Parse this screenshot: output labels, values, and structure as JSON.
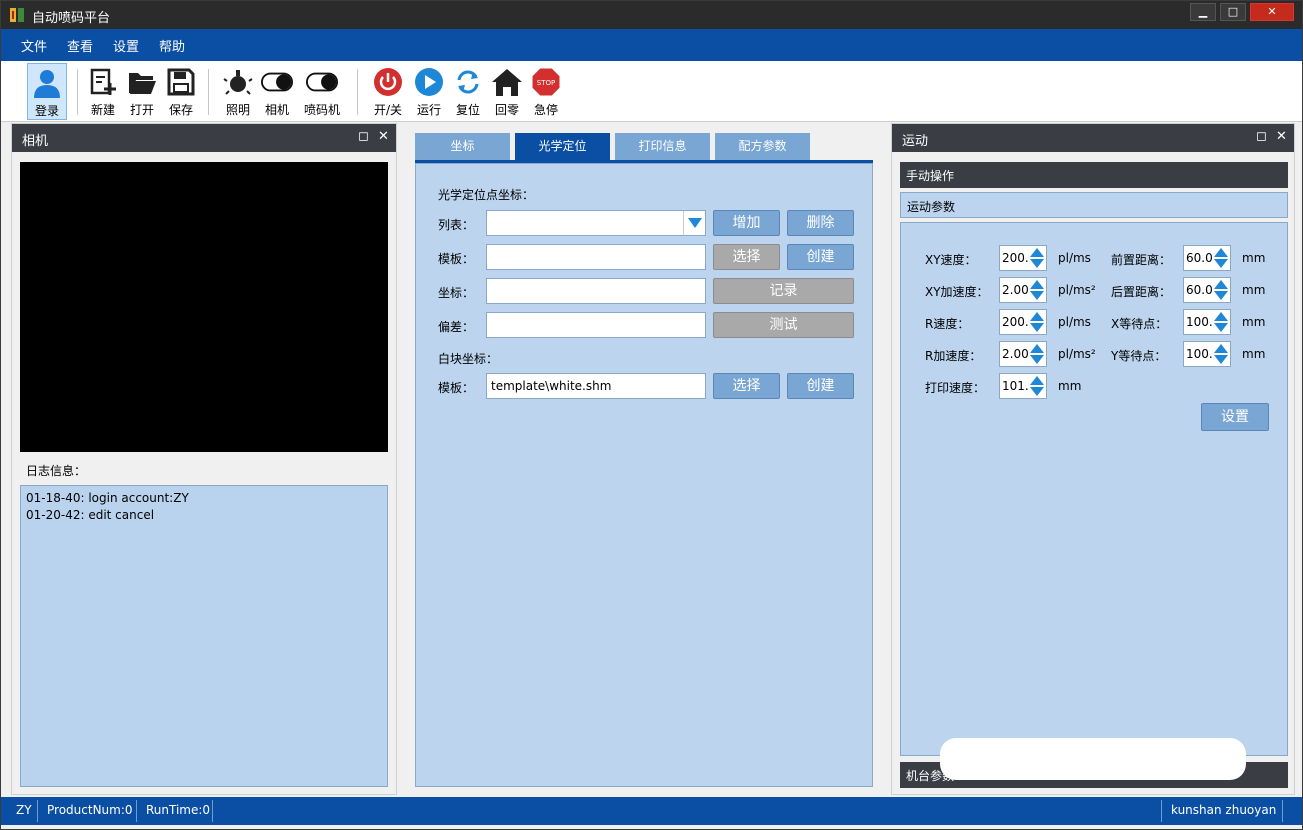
{
  "window": {
    "title": "自动喷码平台"
  },
  "menu": [
    "文件",
    "查看",
    "设置",
    "帮助"
  ],
  "toolbar": {
    "login": "登录",
    "new": "新建",
    "open": "打开",
    "save": "保存",
    "light": "照明",
    "camera": "相机",
    "printer": "喷码机",
    "power": "开/关",
    "run": "运行",
    "reset": "复位",
    "home": "回零",
    "estop": "急停",
    "estop_sign": "STOP"
  },
  "camera_panel": {
    "title": "相机",
    "log_label": "日志信息：",
    "log_lines": [
      "01-18-40: login account:ZY",
      "01-20-42: edit cancel"
    ]
  },
  "center": {
    "tabs": [
      "坐标",
      "光学定位",
      "打印信息",
      "配方参数"
    ],
    "active_tab": "光学定位",
    "optical_section": "光学定位点坐标：",
    "list_label": "列表：",
    "list_value": "",
    "template_label": "模板：",
    "template_value": "",
    "coord_label": "坐标：",
    "coord_value": "",
    "offset_label": "偏差：",
    "offset_value": "",
    "white_section": "白块坐标：",
    "white_template_label": "模板：",
    "white_template_value": "template\\white.shm",
    "btn_add": "增加",
    "btn_delete": "删除",
    "btn_select": "选择",
    "btn_create": "创建",
    "btn_record": "记录",
    "btn_test": "测试"
  },
  "motion_panel": {
    "title": "运动",
    "manual_ops": "手动操作",
    "motion_params": "运动参数",
    "machine_params": "机台参数",
    "settings_button": "设置",
    "rows": [
      {
        "label": "XY速度：",
        "value": "200.",
        "unit": "pl/ms",
        "label2": "前置距离：",
        "value2": "60.0",
        "unit2": "mm"
      },
      {
        "label": "XY加速度：",
        "value": "2.00",
        "unit": "pl/ms²",
        "label2": "后置距离：",
        "value2": "60.0",
        "unit2": "mm"
      },
      {
        "label": "R速度：",
        "value": "200.",
        "unit": "pl/ms",
        "label2": "X等待点：",
        "value2": "100.",
        "unit2": "mm"
      },
      {
        "label": "R加速度：",
        "value": "2.00",
        "unit": "pl/ms²",
        "label2": "Y等待点：",
        "value2": "100.",
        "unit2": "mm"
      },
      {
        "label": "打印速度：",
        "value": "101.",
        "unit": "mm"
      }
    ]
  },
  "statusbar": {
    "user": "ZY",
    "product": "ProductNum:0",
    "runtime": "RunTime:0",
    "company": "kunshan zhuoyan"
  },
  "colors": {
    "accent": "#0b4fa4",
    "panel_bg": "#bcd4ee",
    "header_bg": "#3a3e44",
    "button": "#7aa6d4",
    "disabled": "#a9a9a9"
  }
}
